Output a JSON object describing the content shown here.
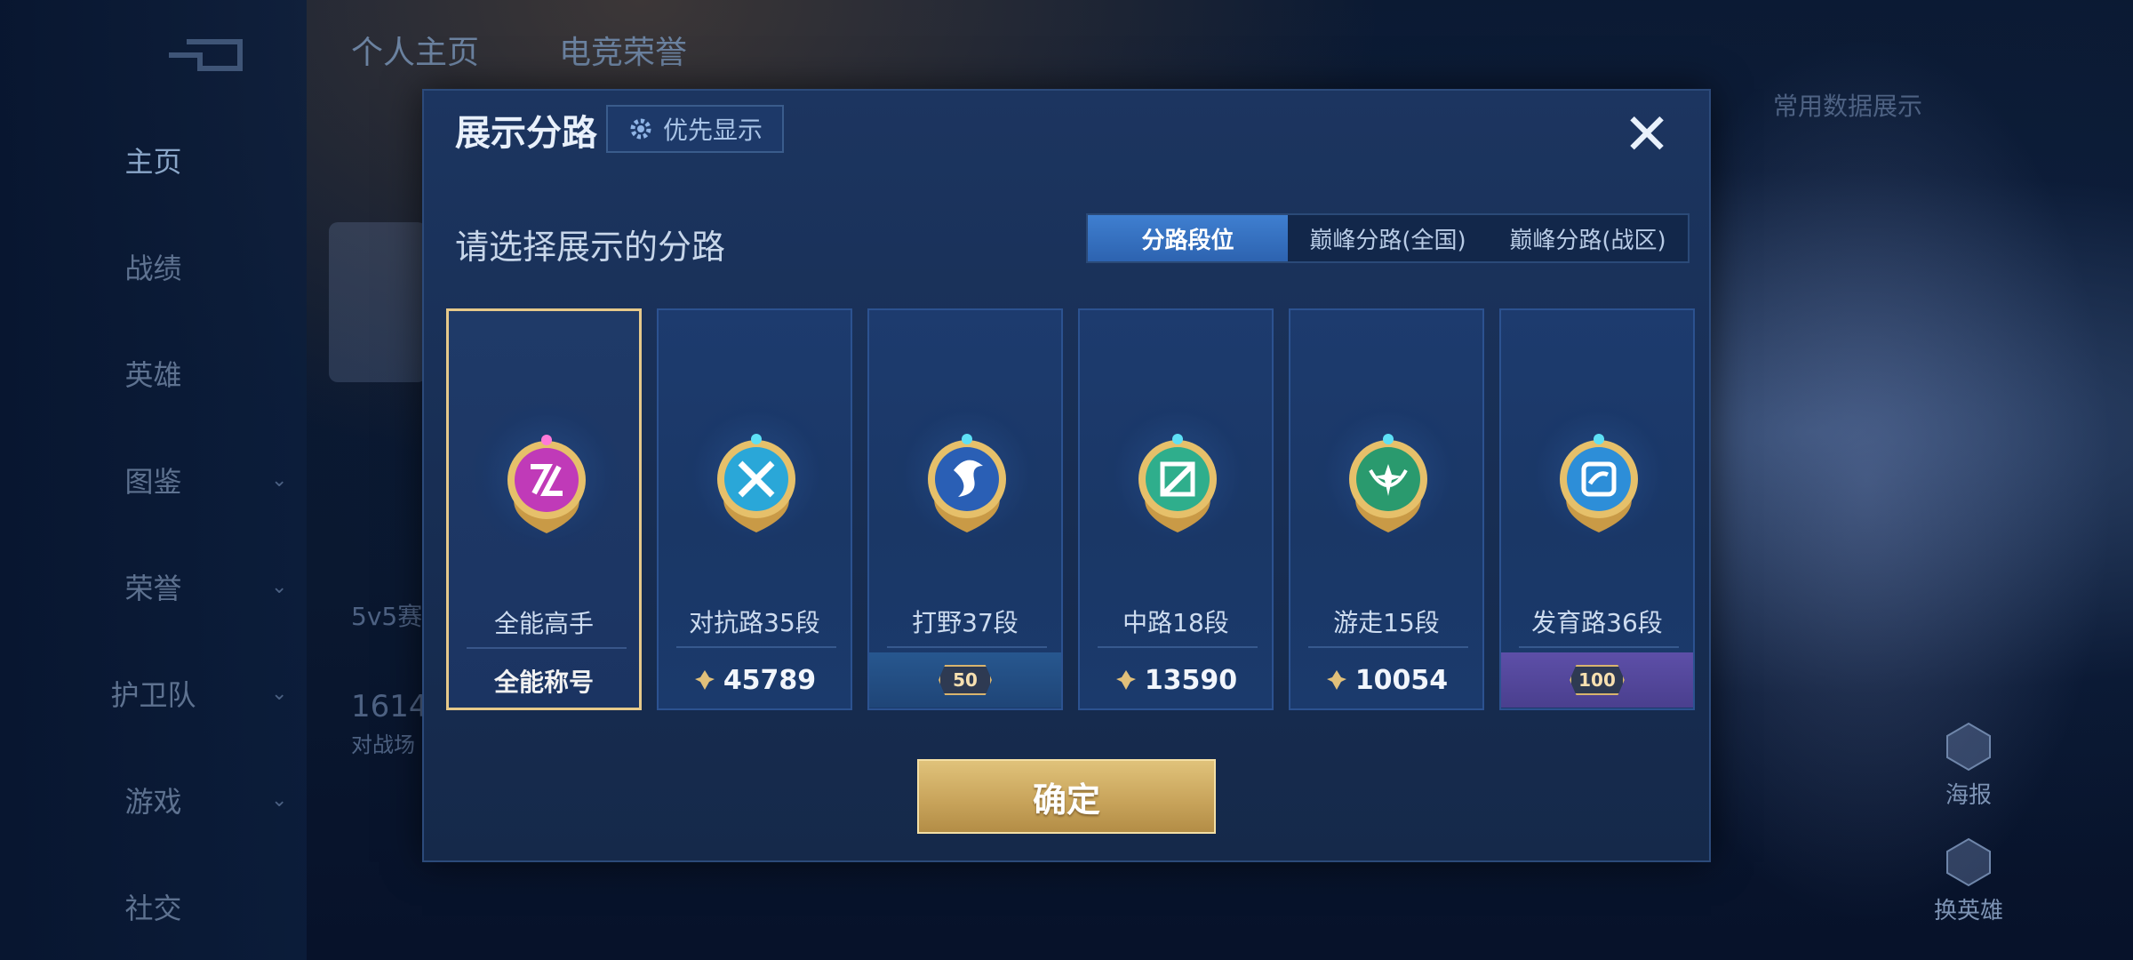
{
  "background": {
    "top_tabs": [
      "个人主页",
      "电竞荣誉"
    ],
    "left_nav": [
      {
        "label": "主页",
        "active": true,
        "has_chevron": false
      },
      {
        "label": "战绩",
        "active": false,
        "has_chevron": false
      },
      {
        "label": "英雄",
        "active": false,
        "has_chevron": false
      },
      {
        "label": "图鉴",
        "active": false,
        "has_chevron": true
      },
      {
        "label": "荣誉",
        "active": false,
        "has_chevron": true
      },
      {
        "label": "护卫队",
        "active": false,
        "has_chevron": true
      },
      {
        "label": "游戏",
        "active": false,
        "has_chevron": true
      },
      {
        "label": "社交",
        "active": false,
        "has_chevron": false
      }
    ],
    "side_texts": [
      "5v5赛",
      "1614",
      "对战场",
      "常用数据展示"
    ],
    "right_buttons": [
      "海报",
      "换英雄"
    ]
  },
  "modal": {
    "title": "展示分路",
    "priority_label": "优先显示",
    "close_symbol": "✕",
    "prompt": "请选择展示的分路",
    "tabs": [
      {
        "label": "分路段位",
        "active": true
      },
      {
        "label": "巅峰分路(全国)",
        "active": false
      },
      {
        "label": "巅峰分路(战区)",
        "active": false
      }
    ],
    "cards": [
      {
        "title": "全能高手",
        "footer": "全能称号",
        "footer_type": "plain",
        "selected": true,
        "emblem_color": "#c03ab8",
        "emblem_icon": "all-rounder-icon"
      },
      {
        "title": "对抗路35段",
        "footer": "45789",
        "footer_type": "points",
        "selected": false,
        "emblem_color": "#2aa7d8",
        "emblem_icon": "clash-lane-icon"
      },
      {
        "title": "打野37段",
        "footer": "50",
        "footer_type": "star-banner",
        "selected": false,
        "emblem_color": "#2a5fb5",
        "emblem_icon": "jungle-icon"
      },
      {
        "title": "中路18段",
        "footer": "13590",
        "footer_type": "points",
        "selected": false,
        "emblem_color": "#2fae8c",
        "emblem_icon": "mid-lane-icon"
      },
      {
        "title": "游走15段",
        "footer": "10054",
        "footer_type": "points",
        "selected": false,
        "emblem_color": "#2a9a6e",
        "emblem_icon": "roam-icon"
      },
      {
        "title": "发育路36段",
        "footer": "100",
        "footer_type": "star-banner-purple",
        "selected": false,
        "emblem_color": "#2d8ed8",
        "emblem_icon": "farm-lane-icon"
      }
    ],
    "confirm_label": "确定"
  }
}
